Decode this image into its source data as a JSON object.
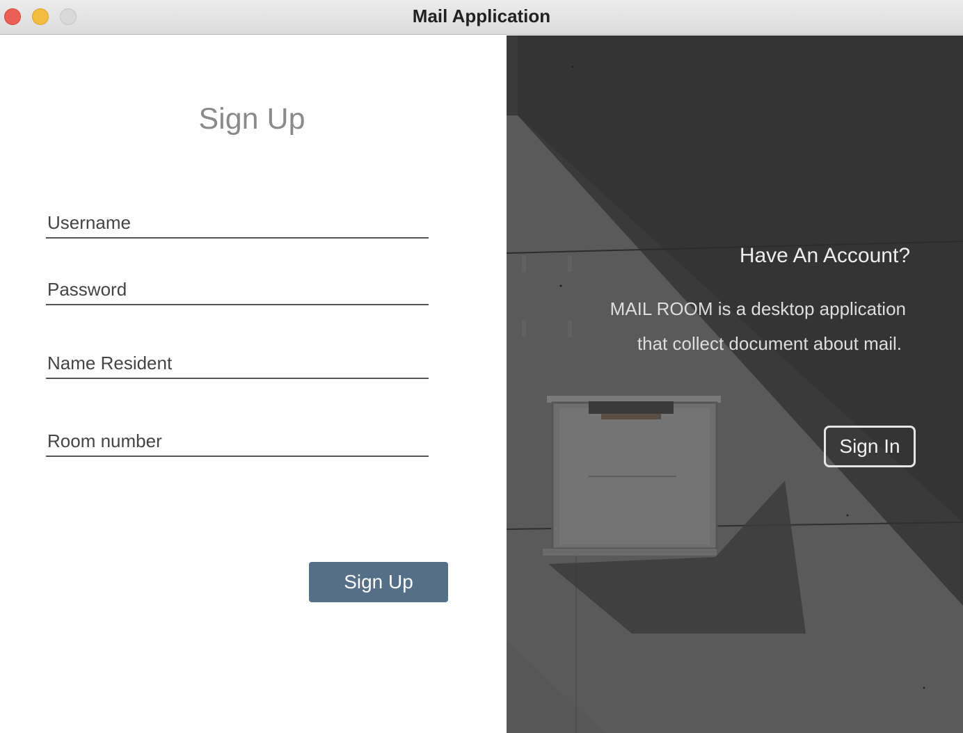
{
  "window": {
    "title": "Mail Application"
  },
  "signup_form": {
    "title": "Sign Up",
    "fields": {
      "username": {
        "placeholder": "Username",
        "value": ""
      },
      "password": {
        "placeholder": "Password",
        "value": ""
      },
      "name_resident": {
        "placeholder": "Name Resident",
        "value": ""
      },
      "room_number": {
        "placeholder": "Room number",
        "value": ""
      }
    },
    "submit_label": "Sign Up"
  },
  "side_panel": {
    "heading": "Have An Account?",
    "description_line1": "MAIL ROOM is a desktop application",
    "description_line2": "that collect document about mail.",
    "signin_label": "Sign In"
  },
  "colors": {
    "accent_button": "#566f88",
    "panel_dark": "#4f4f4f",
    "traffic_close": "#ec5f57",
    "traffic_minimize": "#f5bd3f",
    "traffic_zoom": "#d9d9d9"
  }
}
